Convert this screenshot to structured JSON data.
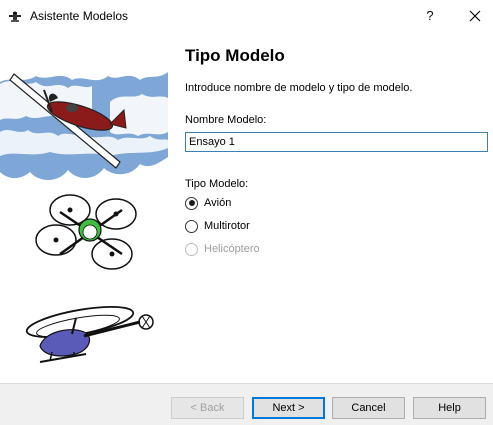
{
  "window": {
    "title": "Asistente Modelos",
    "help_glyph": "?",
    "close_glyph": "✕"
  },
  "page": {
    "heading": "Tipo Modelo",
    "subtitle": "Introduce nombre de modelo y tipo de modelo.",
    "name_label": "Nombre Modelo:",
    "name_value": "Ensayo 1",
    "type_label": "Tipo Modelo:"
  },
  "model_types": [
    {
      "label": "Avión",
      "checked": true,
      "enabled": true
    },
    {
      "label": "Multirotor",
      "checked": false,
      "enabled": true
    },
    {
      "label": "Helicóptero",
      "checked": false,
      "enabled": false
    }
  ],
  "buttons": {
    "back": "< Back",
    "next": "Next >",
    "cancel": "Cancel",
    "help": "Help"
  },
  "colors": {
    "sky": "#7ea6d6",
    "airplane_body": "#8b1a1a",
    "multirotor_center": "#3fbf3f",
    "helicopter_body": "#5a5ab8",
    "focus_border": "#0078d7"
  }
}
